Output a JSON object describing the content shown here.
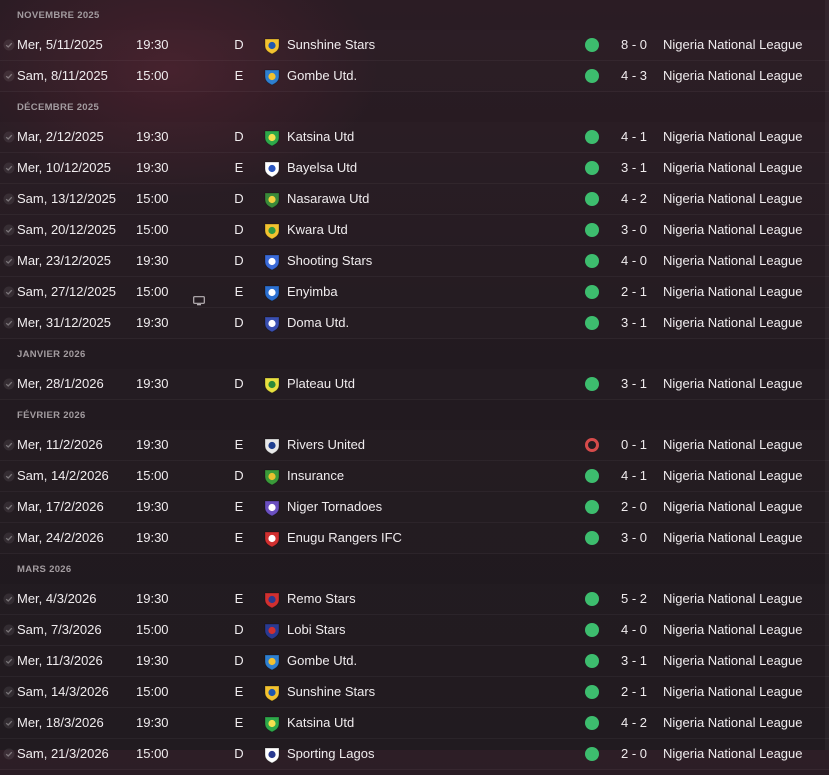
{
  "months": [
    {
      "label": "NOVEMBRE 2025",
      "fixtures": [
        {
          "date": "Mer, 5/11/2025",
          "time": "19:30",
          "venue": "D",
          "opponent": "Sunshine Stars",
          "crest_color": "#f2c230",
          "crest_accent": "#1f57b0",
          "result": "win",
          "score": "8 - 0",
          "competition": "Nigeria National League",
          "tv": false
        },
        {
          "date": "Sam, 8/11/2025",
          "time": "15:00",
          "venue": "E",
          "opponent": "Gombe Utd.",
          "crest_color": "#2e7fd0",
          "crest_accent": "#f2c230",
          "result": "win",
          "score": "4 - 3",
          "competition": "Nigeria National League",
          "tv": false
        }
      ]
    },
    {
      "label": "DÉCEMBRE 2025",
      "fixtures": [
        {
          "date": "Mar, 2/12/2025",
          "time": "19:30",
          "venue": "D",
          "opponent": "Katsina Utd",
          "crest_color": "#2ea84a",
          "crest_accent": "#f5e050",
          "result": "win",
          "score": "4 - 1",
          "competition": "Nigeria National League",
          "tv": false
        },
        {
          "date": "Mer, 10/12/2025",
          "time": "19:30",
          "venue": "E",
          "opponent": "Bayelsa Utd",
          "crest_color": "#ffffff",
          "crest_accent": "#2a55c0",
          "result": "win",
          "score": "3 - 1",
          "competition": "Nigeria National League",
          "tv": false
        },
        {
          "date": "Sam, 13/12/2025",
          "time": "15:00",
          "venue": "D",
          "opponent": "Nasarawa Utd",
          "crest_color": "#3a8a3a",
          "crest_accent": "#f2d040",
          "result": "win",
          "score": "4 - 2",
          "competition": "Nigeria National League",
          "tv": false
        },
        {
          "date": "Sam, 20/12/2025",
          "time": "15:00",
          "venue": "D",
          "opponent": "Kwara Utd",
          "crest_color": "#f2c230",
          "crest_accent": "#2f9a44",
          "result": "win",
          "score": "3 - 0",
          "competition": "Nigeria National League",
          "tv": false
        },
        {
          "date": "Mar, 23/12/2025",
          "time": "19:30",
          "venue": "D",
          "opponent": "Shooting Stars",
          "crest_color": "#3a6ad8",
          "crest_accent": "#ffffff",
          "result": "win",
          "score": "4 - 0",
          "competition": "Nigeria National League",
          "tv": false
        },
        {
          "date": "Sam, 27/12/2025",
          "time": "15:00",
          "venue": "E",
          "opponent": "Enyimba",
          "crest_color": "#2b6fd0",
          "crest_accent": "#ffffff",
          "result": "win",
          "score": "2 - 1",
          "competition": "Nigeria National League",
          "tv": true
        },
        {
          "date": "Mer, 31/12/2025",
          "time": "19:30",
          "venue": "D",
          "opponent": "Doma Utd.",
          "crest_color": "#3a4fb0",
          "crest_accent": "#ffffff",
          "result": "win",
          "score": "3 - 1",
          "competition": "Nigeria National League",
          "tv": false
        }
      ]
    },
    {
      "label": "JANVIER 2026",
      "fixtures": [
        {
          "date": "Mer, 28/1/2026",
          "time": "19:30",
          "venue": "D",
          "opponent": "Plateau Utd",
          "crest_color": "#e8e040",
          "crest_accent": "#2a8a3a",
          "result": "win",
          "score": "3 - 1",
          "competition": "Nigeria National League",
          "tv": false
        }
      ]
    },
    {
      "label": "FÉVRIER 2026",
      "fixtures": [
        {
          "date": "Mer, 11/2/2026",
          "time": "19:30",
          "venue": "E",
          "opponent": "Rivers United",
          "crest_color": "#e8e8e8",
          "crest_accent": "#1f3f90",
          "result": "loss",
          "score": "0 - 1",
          "competition": "Nigeria National League",
          "tv": false
        },
        {
          "date": "Sam, 14/2/2026",
          "time": "15:00",
          "venue": "D",
          "opponent": "Insurance",
          "crest_color": "#3a9a3a",
          "crest_accent": "#e8c030",
          "result": "win",
          "score": "4 - 1",
          "competition": "Nigeria National League",
          "tv": false
        },
        {
          "date": "Mar, 17/2/2026",
          "time": "19:30",
          "venue": "E",
          "opponent": "Niger Tornadoes",
          "crest_color": "#6a4fc0",
          "crest_accent": "#ffffff",
          "result": "win",
          "score": "2 - 0",
          "competition": "Nigeria National League",
          "tv": false
        },
        {
          "date": "Mar, 24/2/2026",
          "time": "19:30",
          "venue": "E",
          "opponent": "Enugu Rangers IFC",
          "crest_color": "#d03030",
          "crest_accent": "#ffffff",
          "result": "win",
          "score": "3 - 0",
          "competition": "Nigeria National League",
          "tv": false
        }
      ]
    },
    {
      "label": "MARS 2026",
      "fixtures": [
        {
          "date": "Mer, 4/3/2026",
          "time": "19:30",
          "venue": "E",
          "opponent": "Remo Stars",
          "crest_color": "#d03030",
          "crest_accent": "#2a3a90",
          "result": "win",
          "score": "5 - 2",
          "competition": "Nigeria National League",
          "tv": false
        },
        {
          "date": "Sam, 7/3/2026",
          "time": "15:00",
          "venue": "D",
          "opponent": "Lobi Stars",
          "crest_color": "#2a3a90",
          "crest_accent": "#d03030",
          "result": "win",
          "score": "4 - 0",
          "competition": "Nigeria National League",
          "tv": false
        },
        {
          "date": "Mer, 11/3/2026",
          "time": "19:30",
          "venue": "D",
          "opponent": "Gombe Utd.",
          "crest_color": "#2e7fd0",
          "crest_accent": "#f2c230",
          "result": "win",
          "score": "3 - 1",
          "competition": "Nigeria National League",
          "tv": false
        },
        {
          "date": "Sam, 14/3/2026",
          "time": "15:00",
          "venue": "E",
          "opponent": "Sunshine Stars",
          "crest_color": "#f2c230",
          "crest_accent": "#1f57b0",
          "result": "win",
          "score": "2 - 1",
          "competition": "Nigeria National League",
          "tv": false
        },
        {
          "date": "Mer, 18/3/2026",
          "time": "19:30",
          "venue": "E",
          "opponent": "Katsina Utd",
          "crest_color": "#2ea84a",
          "crest_accent": "#f5e050",
          "result": "win",
          "score": "4 - 2",
          "competition": "Nigeria National League",
          "tv": false
        },
        {
          "date": "Sam, 21/3/2026",
          "time": "15:00",
          "venue": "D",
          "opponent": "Sporting Lagos",
          "crest_color": "#ffffff",
          "crest_accent": "#2a3a90",
          "result": "win",
          "score": "2 - 0",
          "competition": "Nigeria National League",
          "tv": false
        }
      ]
    }
  ]
}
